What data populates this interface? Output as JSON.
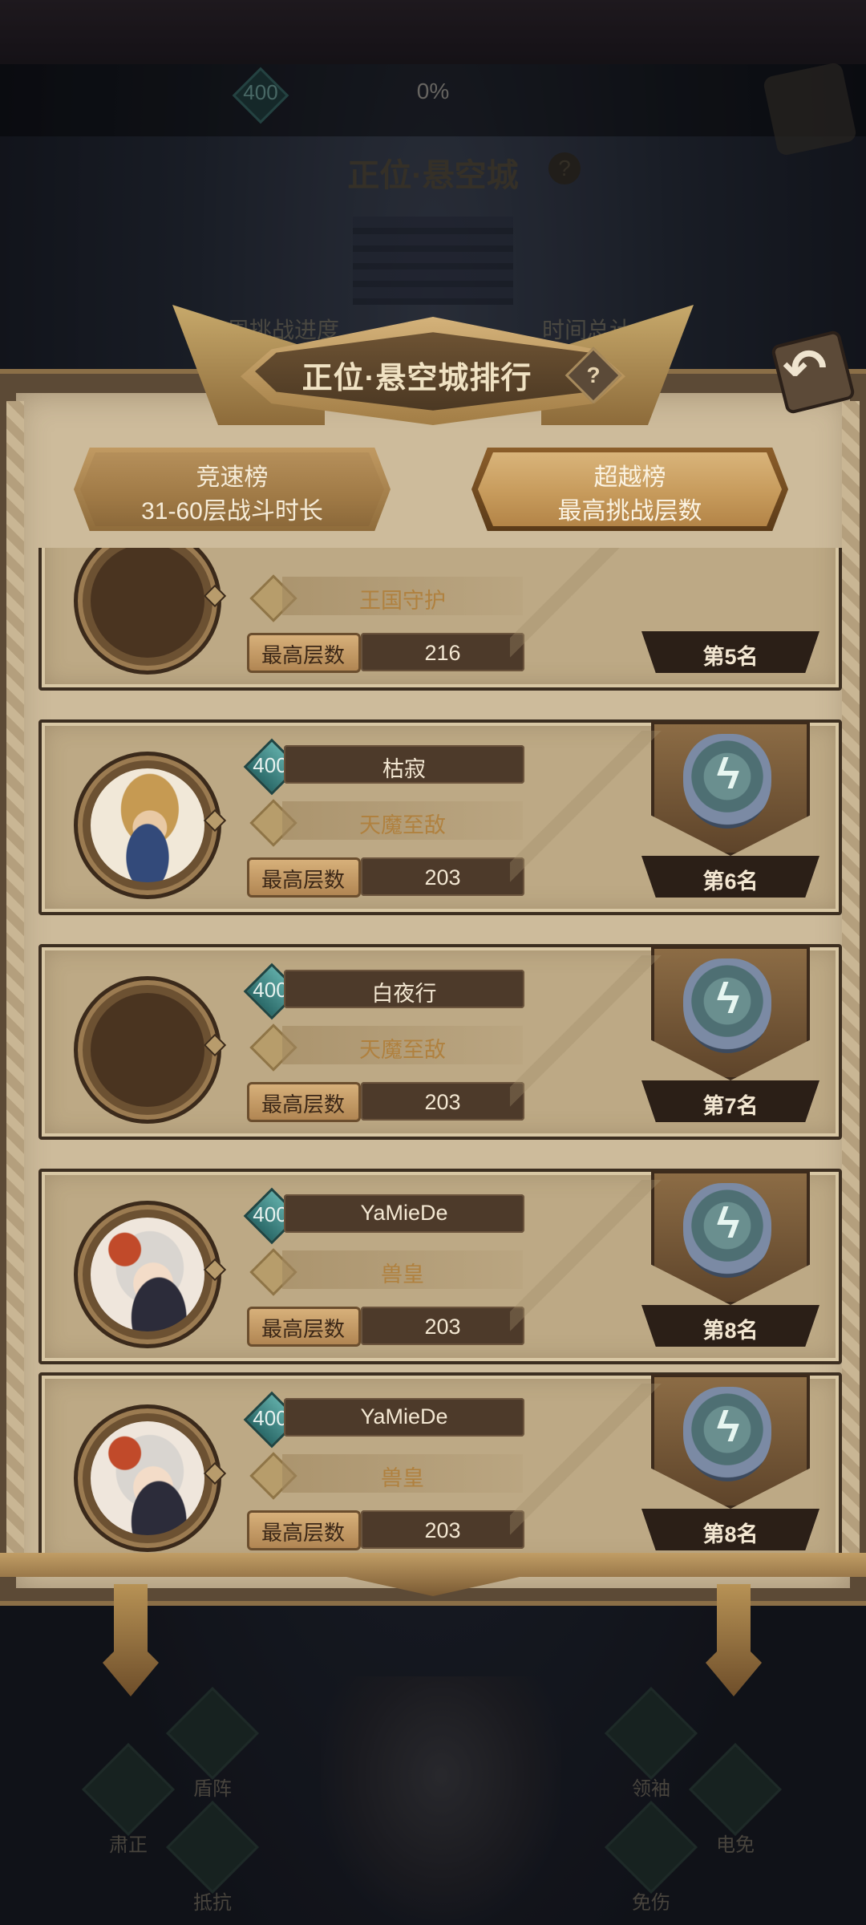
{
  "background": {
    "rank_level": "400",
    "progress": "0%",
    "title": "正位·悬空城",
    "help": "?",
    "week_progress": "本周挑战进度",
    "time_total": "时间总计",
    "skills": [
      {
        "label": "盾阵",
        "icon": "shield-icon"
      },
      {
        "label": "肃正",
        "icon": "sword-icon"
      },
      {
        "label": "抵抗",
        "icon": "shield-icon"
      },
      {
        "label": "领袖",
        "icon": "crown-icon"
      },
      {
        "label": "电免",
        "icon": "lightning-icon"
      },
      {
        "label": "免伤",
        "icon": "shield-icon"
      }
    ]
  },
  "panel": {
    "title": "正位·悬空城排行",
    "help": "?",
    "back_icon": "back-arrow-icon"
  },
  "tabs": [
    {
      "title": "竞速榜",
      "subtitle": "31-60层战斗时长",
      "active": false
    },
    {
      "title": "超越榜",
      "subtitle": "最高挑战层数",
      "active": true
    }
  ],
  "floor_label": "最高层数",
  "rows": [
    {
      "level": "",
      "name": "",
      "title": "王国守护",
      "floor": "216",
      "rank": "第5名",
      "portrait": "empty"
    },
    {
      "level": "400",
      "name": "枯寂",
      "title": "天魔至敌",
      "floor": "203",
      "rank": "第6名",
      "portrait": "knight"
    },
    {
      "level": "400",
      "name": "白夜行",
      "title": "天魔至敌",
      "floor": "203",
      "rank": "第7名",
      "portrait": "empty"
    },
    {
      "level": "400",
      "name": "YaMieDe",
      "title": "兽皇",
      "floor": "203",
      "rank": "第8名",
      "portrait": "fox"
    },
    {
      "level": "400",
      "name": "YaMieDe",
      "title": "兽皇",
      "floor": "203",
      "rank": "第8名",
      "portrait": "fox"
    }
  ],
  "colors": {
    "panel_bg": "#cdbb9b",
    "bar_dark": "#4d3a2a",
    "title_gold": "#b0813f",
    "level_teal": "#2b6a69"
  }
}
